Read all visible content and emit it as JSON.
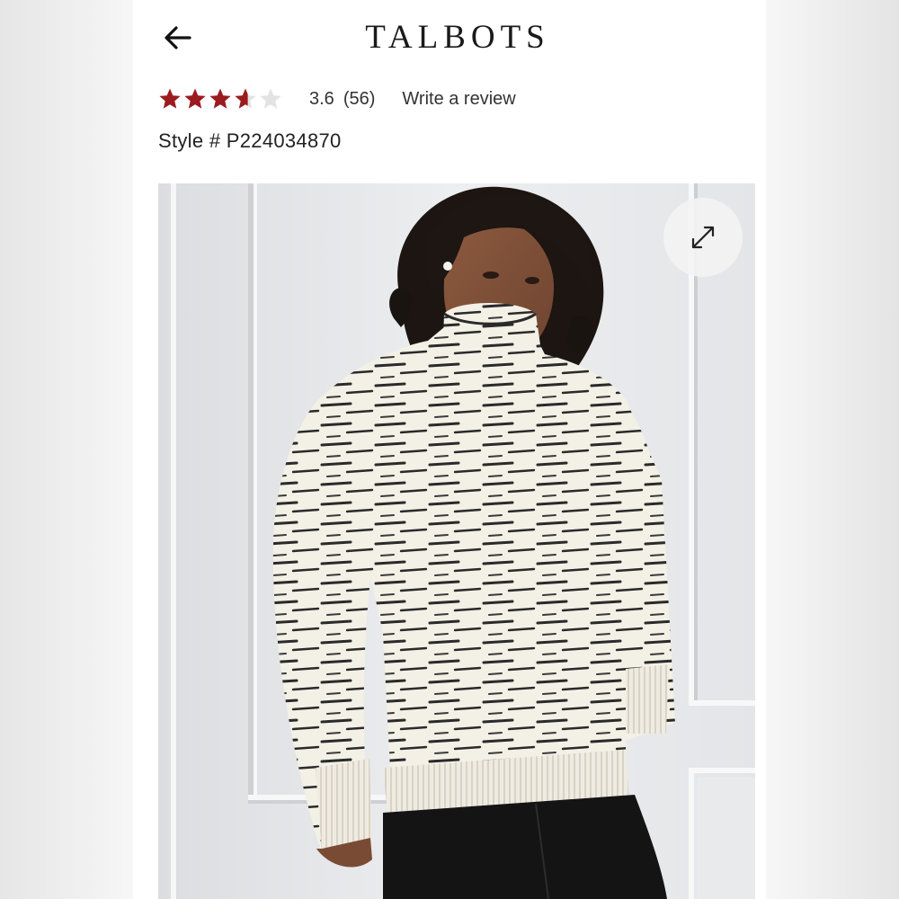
{
  "header": {
    "back_icon": "arrow-left-icon",
    "brand": "TALBOTS"
  },
  "product": {
    "rating": {
      "value": 3.6,
      "max": 5,
      "value_text": "3.6",
      "count_text": "(56)",
      "star_color": "#9b1b1e",
      "empty_star_color": "#e3e3e3"
    },
    "write_review_label": "Write a review",
    "style_number": "Style # P224034870"
  },
  "image": {
    "alt": "Model wearing a cream and black space-dyed turtleneck sweater",
    "expand_icon": "expand-arrows-icon"
  }
}
